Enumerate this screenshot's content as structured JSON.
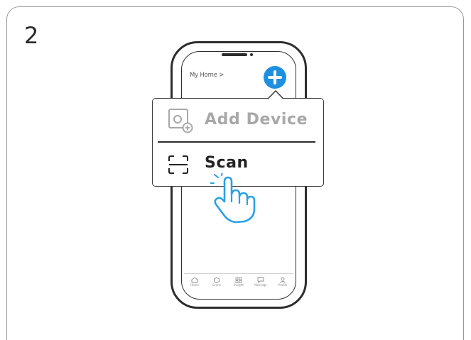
{
  "step": {
    "number": "2"
  },
  "phone": {
    "header": {
      "home_label": "My Home >"
    },
    "add_button": {
      "icon": "plus-icon",
      "color": "#1f8fe0"
    },
    "bottom_nav": {
      "items": [
        {
          "label": "Home",
          "icon": "home-icon"
        },
        {
          "label": "Scene",
          "icon": "scene-icon"
        },
        {
          "label": "Insight",
          "icon": "insight-icon"
        },
        {
          "label": "Message",
          "icon": "message-icon"
        },
        {
          "label": "Profile",
          "icon": "profile-icon"
        }
      ]
    }
  },
  "popup_menu": {
    "items": [
      {
        "label": "Add Device",
        "icon": "add-device-icon",
        "state": "disabled",
        "color": "#a8a8a8"
      },
      {
        "label": "Scan",
        "icon": "scan-icon",
        "state": "active",
        "color": "#222222"
      }
    ]
  },
  "pointer": {
    "icon": "hand-pointer-icon"
  }
}
